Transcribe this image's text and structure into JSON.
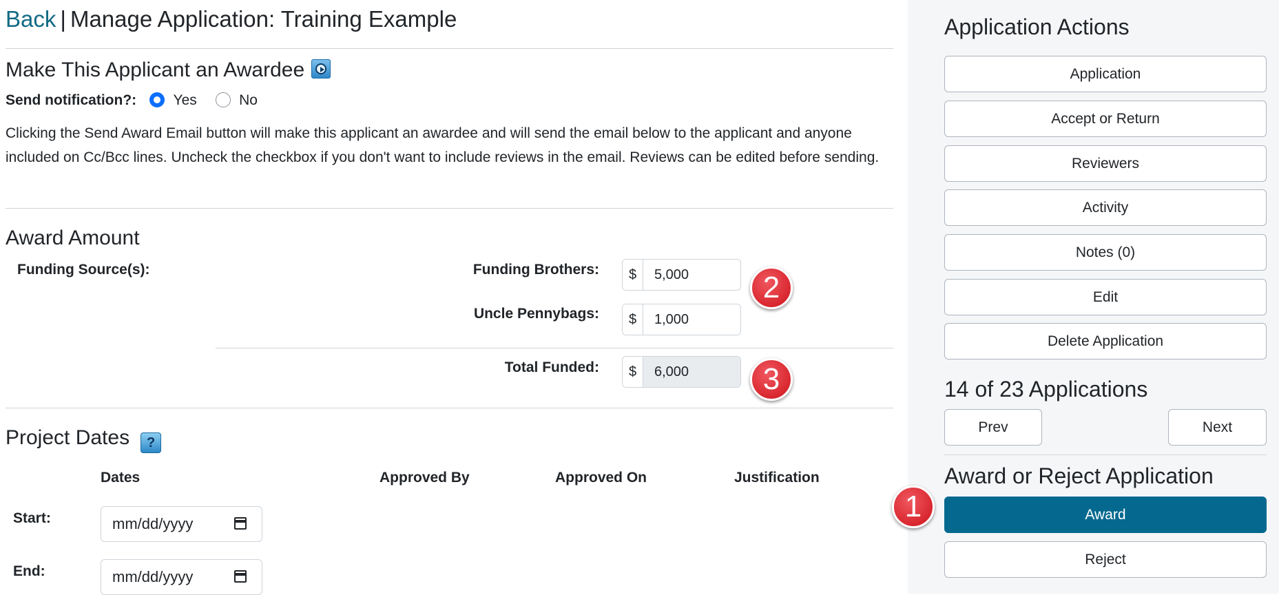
{
  "header": {
    "back_label": "Back",
    "separator": "|",
    "title": "Manage Application: Training Example"
  },
  "awardee": {
    "heading": "Make This Applicant an Awardee",
    "info_icon": "play-video-icon",
    "send_notification_label": "Send notification?:",
    "radio_yes": "Yes",
    "radio_no": "No",
    "selected": "Yes",
    "description": "Clicking the Send Award Email button will make this applicant an awardee and will send the email below to the applicant and anyone included on Cc/Bcc lines. Uncheck the checkbox if you don't want to include reviews in the email. Reviews can be edited before sending."
  },
  "award_amount": {
    "heading": "Award Amount",
    "funding_sources_label": "Funding Source(s):",
    "currency": "$",
    "sources": [
      {
        "label": "Funding Brothers:",
        "value": "5,000"
      },
      {
        "label": "Uncle Pennybags:",
        "value": "1,000"
      }
    ],
    "total_label": "Total Funded:",
    "total_value": "6,000"
  },
  "project_dates": {
    "heading": "Project Dates",
    "help_icon": "question-icon",
    "help_glyph": "?",
    "columns": [
      "Dates",
      "Approved By",
      "Approved On",
      "Justification"
    ],
    "start_label": "Start:",
    "end_label": "End:",
    "date_placeholder": "mm/dd/yyyy"
  },
  "annotations": {
    "badge_1": "1",
    "badge_2": "2",
    "badge_3": "3",
    "badge_color": "#d9272f"
  },
  "sidebar": {
    "actions_heading": "Application Actions",
    "actions": [
      "Application",
      "Accept or Return",
      "Reviewers",
      "Activity",
      "Notes (0)",
      "Edit",
      "Delete Application"
    ],
    "count_text": "14 of 23 Applications",
    "prev_label": "Prev",
    "next_label": "Next",
    "award_heading": "Award or Reject Application",
    "award_label": "Award",
    "reject_label": "Reject"
  },
  "colors": {
    "link": "#116a85",
    "primary_button": "#05698f",
    "sidebar_bg": "#f5f6f8"
  }
}
